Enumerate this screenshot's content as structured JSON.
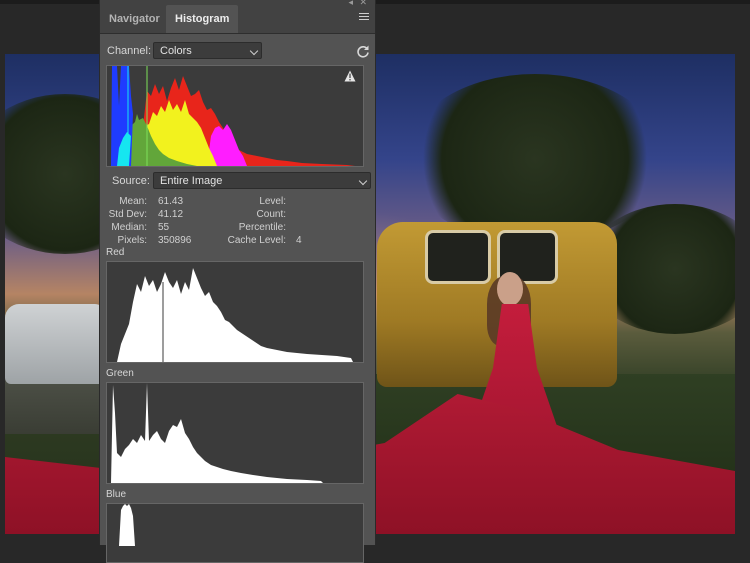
{
  "panel": {
    "tabs": [
      {
        "label": "Navigator"
      },
      {
        "label": "Histogram"
      }
    ],
    "channel": {
      "label": "Channel:",
      "value": "Colors"
    },
    "source": {
      "label": "Source:",
      "value": "Entire Image"
    },
    "stats": {
      "mean": {
        "label": "Mean:",
        "value": "61.43"
      },
      "std_dev": {
        "label": "Std Dev:",
        "value": "41.12"
      },
      "median": {
        "label": "Median:",
        "value": "55"
      },
      "pixels": {
        "label": "Pixels:",
        "value": "350896"
      },
      "level": {
        "label": "Level:",
        "value": ""
      },
      "count": {
        "label": "Count:",
        "value": ""
      },
      "percentile": {
        "label": "Percentile:",
        "value": ""
      },
      "cache_level": {
        "label": "Cache Level:",
        "value": "4"
      }
    },
    "channels": {
      "red": "Red",
      "green": "Green",
      "blue": "Blue"
    }
  },
  "colors": {
    "panel_bg": "#535353",
    "histogram_bg": "#3b3b3b",
    "red": "#e8251b",
    "green": "#62a63a",
    "blue": "#1f3cff",
    "yellow": "#f2f21e",
    "magenta": "#ff1dff",
    "cyan": "#16e6f0"
  },
  "icons": {
    "panel_menu": "hamburger-menu-icon",
    "refresh": "refresh-icon",
    "warning": "warning-triangle-icon"
  }
}
